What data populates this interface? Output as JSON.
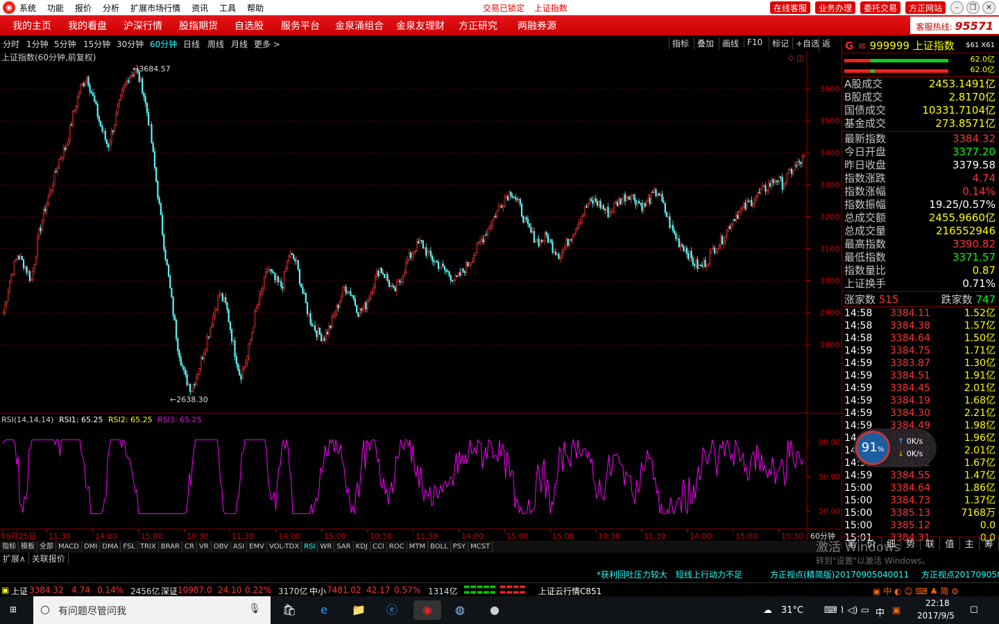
{
  "titlebar": {
    "menus": [
      "系统",
      "功能",
      "报价",
      "分析",
      "扩展市场行情",
      "资讯",
      "工具",
      "帮助"
    ],
    "center_status": "交易已锁定",
    "center_title": "上证指数",
    "buttons": [
      "在线客服",
      "业务办理",
      "委托交易",
      "方正网站"
    ]
  },
  "menubar": {
    "items": [
      "我的主页",
      "我的看盘",
      "沪深行情",
      "股指期货",
      "自选股",
      "服务平台",
      "金泉涌组合",
      "金泉友理财",
      "方正研究",
      "两融券源"
    ],
    "hotline_label": "客服热线:",
    "hotline_number": "95571"
  },
  "periodbar": {
    "periods": [
      "分时",
      "1分钟",
      "5分钟",
      "15分钟",
      "30分钟",
      "60分钟",
      "日线",
      "周线",
      "月线",
      "更多 >"
    ],
    "selected": "60分钟",
    "right_tools": [
      "指标",
      "叠加",
      "画线",
      "F10",
      "标记",
      "+自选",
      "返回"
    ]
  },
  "chart": {
    "title": "上证指数(60分钟,前复权)",
    "high_label": "3684.57",
    "low_label": "2638.30",
    "price_axis": [
      "3600",
      "3500",
      "3400",
      "3300",
      "3200",
      "3100",
      "3000",
      "2900",
      "2800"
    ],
    "rsi_header_name": "RSI(14,14,14)",
    "rsi1": "RSI1: 65.25",
    "rsi2": "RSI2: 65.25",
    "rsi3": "RSI3: 65.25",
    "rsi_axis": [
      "80.00",
      "50.00",
      "20.00"
    ],
    "time_axis": [
      "08月25日",
      "11:30",
      "14:00",
      "15:00",
      "10:30",
      "11:30",
      "14:00",
      "15:00",
      "10:30",
      "11:30",
      "14:00",
      "15:00",
      "15:00",
      "10:30",
      "11:30",
      "14:00",
      "15:00",
      "10:30"
    ],
    "period_label": "60分钟"
  },
  "chart_data": {
    "type": "candlestick",
    "title": "上证指数(60分钟,前复权)",
    "ylim": [
      2600,
      3700
    ],
    "close_path": [
      2900,
      3010,
      3080,
      3050,
      3000,
      3140,
      3230,
      3300,
      3380,
      3420,
      3520,
      3600,
      3640,
      3560,
      3480,
      3420,
      3500,
      3580,
      3640,
      3660,
      3600,
      3480,
      3300,
      3120,
      2960,
      2800,
      2700,
      2660,
      2720,
      2800,
      2880,
      2960,
      2920,
      2800,
      2700,
      2760,
      2880,
      2960,
      3040,
      3000,
      2980,
      3080,
      3060,
      2960,
      2880,
      2840,
      2820,
      2860,
      2920,
      2980,
      2960,
      2900,
      2920,
      2980,
      3040,
      3010,
      2960,
      3000,
      3060,
      3100,
      3120,
      3080,
      3060,
      3040,
      3020,
      3000,
      3030,
      3060,
      3100,
      3140,
      3180,
      3220,
      3260,
      3280,
      3240,
      3180,
      3140,
      3120,
      3140,
      3100,
      3080,
      3120,
      3160,
      3200,
      3240,
      3250,
      3230,
      3210,
      3240,
      3260,
      3270,
      3250,
      3230,
      3260,
      3280,
      3220,
      3160,
      3120,
      3100,
      3060,
      3040,
      3060,
      3100,
      3120,
      3160,
      3200,
      3220,
      3240,
      3260,
      3280,
      3300,
      3320,
      3300,
      3340,
      3360,
      3384
    ],
    "high": 3684.57,
    "low": 2638.3,
    "rsi_last": 65.25
  },
  "right_panel": {
    "code": "999999",
    "name": "上证指数",
    "tag": "$61 X61",
    "bar_pct_1": "62.0亿",
    "bar_pct_2": "62.0亿",
    "volumes": [
      {
        "k": "A股成交",
        "v": "2453.1491亿"
      },
      {
        "k": "B股成交",
        "v": "2.8170亿"
      },
      {
        "k": "国债成交",
        "v": "10331.7104亿"
      },
      {
        "k": "基金成交",
        "v": "273.8571亿"
      }
    ],
    "stats": [
      {
        "k": "最新指数",
        "v": "3384.32",
        "c": "rd"
      },
      {
        "k": "今日开盘",
        "v": "3377.20",
        "c": "gr"
      },
      {
        "k": "昨日收盘",
        "v": "3379.58",
        "c": "wt"
      },
      {
        "k": "指数涨跌",
        "v": "4.74",
        "c": "rd"
      },
      {
        "k": "指数涨幅",
        "v": "0.14%",
        "c": "rd"
      },
      {
        "k": "指数振幅",
        "v": "19.25/0.57%",
        "c": "wt"
      },
      {
        "k": "总成交额",
        "v": "2455.9660亿",
        "c": "y"
      },
      {
        "k": "总成交量",
        "v": "216552946",
        "c": "y"
      },
      {
        "k": "最高指数",
        "v": "3390.82",
        "c": "rd"
      },
      {
        "k": "最低指数",
        "v": "3371.57",
        "c": "gr"
      },
      {
        "k": "指数量比",
        "v": "0.87",
        "c": "y"
      },
      {
        "k": "上证换手",
        "v": "0.71%",
        "c": "wt"
      }
    ],
    "up_label": "涨家数",
    "up_count": "515",
    "down_label": "跌家数",
    "down_count": "747",
    "ticks": [
      {
        "t": "14:58",
        "v": "3384.11",
        "a": "1.52亿"
      },
      {
        "t": "14:58",
        "v": "3384.38",
        "a": "1.57亿"
      },
      {
        "t": "14:58",
        "v": "3384.64",
        "a": "1.50亿"
      },
      {
        "t": "14:59",
        "v": "3384.75",
        "a": "1.71亿"
      },
      {
        "t": "14:59",
        "v": "3383.87",
        "a": "1.30亿"
      },
      {
        "t": "14:59",
        "v": "3384.51",
        "a": "1.91亿"
      },
      {
        "t": "14:59",
        "v": "3384.45",
        "a": "2.01亿"
      },
      {
        "t": "14:59",
        "v": "3384.19",
        "a": "1.68亿"
      },
      {
        "t": "14:59",
        "v": "3384.30",
        "a": "2.21亿"
      },
      {
        "t": "14:59",
        "v": "3384.49",
        "a": "1.98亿"
      },
      {
        "t": "14:59",
        "v": "3384.33",
        "a": "1.96亿"
      },
      {
        "t": "14:59",
        "v": "3384.22",
        "a": "2.01亿"
      },
      {
        "t": "14:59",
        "v": "3384.02",
        "a": "1.67亿"
      },
      {
        "t": "14:59",
        "v": "3384.55",
        "a": "1.47亿"
      },
      {
        "t": "15:00",
        "v": "3384.64",
        "a": "1.86亿"
      },
      {
        "t": "15:00",
        "v": "3384.73",
        "a": "1.37亿"
      },
      {
        "t": "15:00",
        "v": "3385.13",
        "a": "7168万"
      },
      {
        "t": "15:00",
        "v": "3385.12",
        "a": "0.0"
      },
      {
        "t": "15:01",
        "v": "3384.31",
        "a": "0.0"
      }
    ],
    "bottom_tabs": [
      "笔",
      "价",
      "细",
      "势",
      "联",
      "值",
      "主",
      "筹"
    ]
  },
  "bottom_tabs": [
    "指标",
    "模板",
    "全部",
    "MACD",
    "DMI",
    "DMA",
    "FSL",
    "TRIX",
    "BRAR",
    "CR",
    "VR",
    "OBV",
    "ASI",
    "EMV",
    "VOL-TDX",
    "RSI",
    "WR",
    "SAR",
    "KDJ",
    "CCI",
    "ROC",
    "MTM",
    "BOLL",
    "PSY",
    "MCST"
  ],
  "selected_indicator": "RSI",
  "ext_tabs": [
    "扩展∧",
    "关联报价"
  ],
  "status": {
    "news1": "*获利回吐压力较大",
    "news2": "短线上行动力不足",
    "news3": "方正视点(精简版)20170905040011",
    "news4": "方正视点20170905030"
  },
  "quote": {
    "sh_label": "上证",
    "sh_val": "3384.32",
    "sh_chg": "4.74",
    "sh_pct": "0.14%",
    "sh_amt": "2456亿",
    "sz_label": "深证",
    "sz_val": "10987.0",
    "sz_chg": "24.10",
    "sz_pct": "0.22%",
    "sz_amt": "3170亿",
    "zx_label": "中小",
    "zx_val": "7481.02",
    "zx_chg": "42.17",
    "zx_pct": "0.57%",
    "zx_amt": "1314亿",
    "cloud": "上证云行情C851"
  },
  "speed": {
    "pct": "91",
    "unit": "%",
    "up": "0K/s",
    "down": "0K/s"
  },
  "watermark": {
    "line1": "激活 Windows",
    "line2": "转到\"设置\"以激活 Windows。"
  },
  "taskbar": {
    "search_placeholder": "有问题尽管问我",
    "temp": "31°C",
    "ime": "中",
    "time": "22:18",
    "date": "2017/9/5"
  }
}
